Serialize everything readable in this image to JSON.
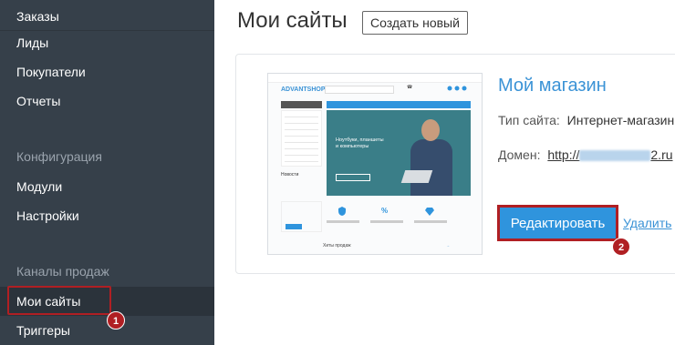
{
  "sidebar": {
    "items_top": [
      {
        "label": "Заказы"
      },
      {
        "label": "Лиды"
      },
      {
        "label": "Покупатели"
      },
      {
        "label": "Отчеты"
      }
    ],
    "config_header": "Конфигурация",
    "config_items": [
      {
        "label": "Модули"
      },
      {
        "label": "Настройки"
      }
    ],
    "channels_header": "Каналы продаж",
    "channel_items": [
      {
        "label": "Мои сайты",
        "active": true
      },
      {
        "label": "Триггеры"
      }
    ]
  },
  "header": {
    "title": "Мои сайты",
    "create_label": "Создать новый"
  },
  "site": {
    "name": "Мой магазин",
    "type_label": "Тип сайта:",
    "type_value": "Интернет-магазин",
    "domain_label": "Домен:",
    "domain_prefix": "http://",
    "domain_suffix": "2.ru",
    "edit_label": "Редактировать",
    "delete_label": "Удалить"
  },
  "thumbnail": {
    "logo": "ADVANTSHOP",
    "hero_text_1": "Ноутбуки, планшеты",
    "hero_text_2": "и компьютеры",
    "news": "Новости",
    "bottom": "Хиты продаж"
  },
  "callouts": {
    "badge_1": "1",
    "badge_2": "2"
  },
  "colors": {
    "sidebar_bg": "#36404a",
    "accent": "#2f94dd",
    "callout": "#b01f23"
  }
}
